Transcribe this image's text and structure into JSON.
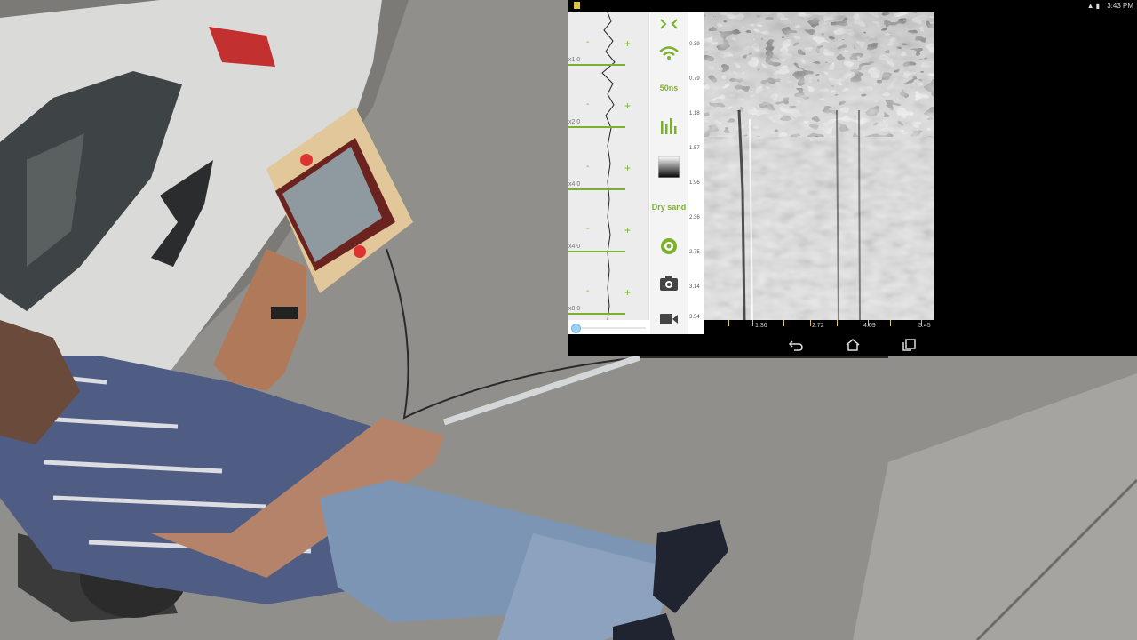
{
  "status_bar": {
    "time": "3:43 PM",
    "icons": [
      "wifi-icon",
      "battery-icon"
    ]
  },
  "gain_panel": {
    "minus": "-",
    "plus": "+",
    "gain_levels": [
      "x1.0",
      "x2.0",
      "x4.0",
      "x4.0",
      "x8.0"
    ]
  },
  "toolbar": {
    "items": [
      {
        "name": "collapse-toggle",
        "icon": "chevrons-icon"
      },
      {
        "name": "antenna",
        "icon": "wifi-signal-icon"
      },
      {
        "name": "time-range",
        "label": "50ns"
      },
      {
        "name": "gain-bars",
        "icon": "bar-chart-icon"
      },
      {
        "name": "contrast",
        "icon": "gradient-icon"
      },
      {
        "name": "soil-type",
        "label": "Dry sand"
      },
      {
        "name": "record",
        "icon": "record-icon"
      },
      {
        "name": "camera",
        "icon": "camera-icon"
      },
      {
        "name": "video",
        "icon": "video-camera-icon"
      }
    ]
  },
  "depth_axis": [
    "0.39",
    "0.79",
    "1.18",
    "1.57",
    "1.96",
    "2.36",
    "2.75",
    "3.14",
    "3.54"
  ],
  "distance_axis": [
    "1.36",
    "2.72",
    "4.09",
    "5.45"
  ],
  "colors": {
    "accent": "#7cb22b",
    "marker": "#d8c64a"
  },
  "navbar": [
    "back-icon",
    "home-icon",
    "recents-icon"
  ]
}
